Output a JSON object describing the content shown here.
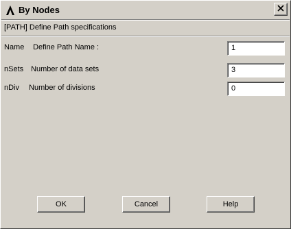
{
  "window": {
    "title": "By Nodes",
    "close_icon": "close-icon",
    "app_icon": "ansys-logo-icon"
  },
  "header": {
    "text": "[PATH]  Define Path specifications"
  },
  "fields": [
    {
      "key": "Name",
      "description": "Define Path Name :",
      "value": "1"
    },
    {
      "key": "nSets",
      "description": "Number of data sets",
      "value": "3"
    },
    {
      "key": "nDiv",
      "description": "Number of divisions",
      "value": "0"
    }
  ],
  "buttons": {
    "ok": "OK",
    "cancel": "Cancel",
    "help": "Help"
  },
  "colors": {
    "face": "#d4d0c8",
    "field_bg": "#ffffff"
  }
}
